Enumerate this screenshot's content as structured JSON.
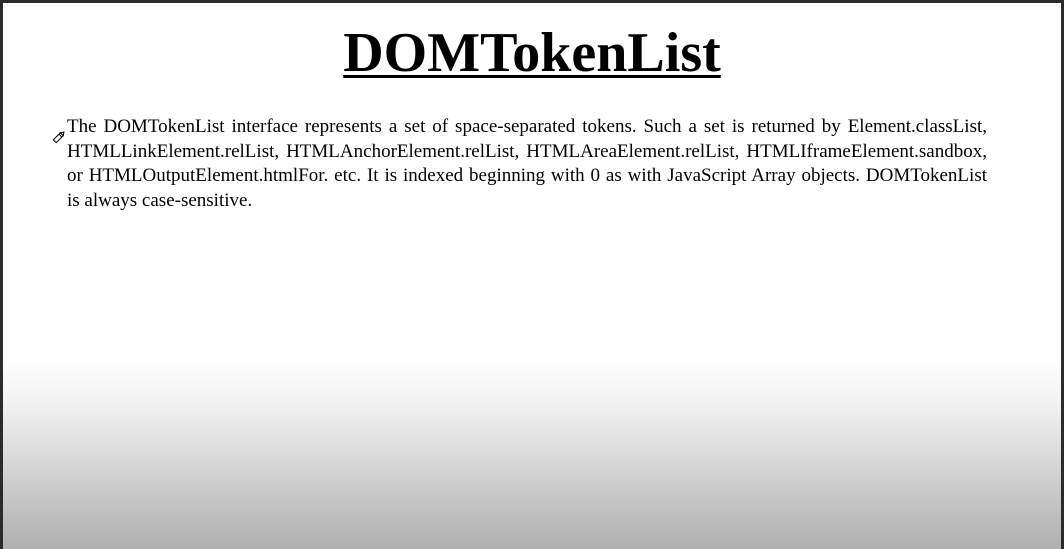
{
  "slide": {
    "title": "DOMTokenList",
    "paragraph": "The DOMTokenList interface represents a set of space-separated tokens. Such a set is returned by Element.classList, HTMLLinkElement.relList, HTMLAnchorElement.relList, HTMLAreaElement.relList, HTMLIframeElement.sandbox, or HTMLOutputElement.htmlFor.  etc. It is indexed beginning with 0 as with JavaScript Array objects. DOMTokenList is always case-sensitive."
  },
  "icons": {
    "cursor": "pencil-icon"
  },
  "colors": {
    "text": "#000000",
    "background": "#ffffff",
    "frame": "#2b2b2b"
  }
}
